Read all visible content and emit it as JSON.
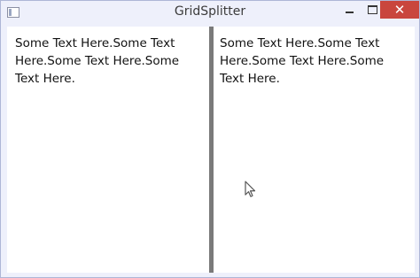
{
  "window": {
    "title": "GridSplitter",
    "controls": {
      "minimize_icon": "minimize-icon",
      "maximize_icon": "maximize-icon",
      "close_icon": "close-icon",
      "close_glyph": "✕"
    }
  },
  "panes": {
    "left_text": "Some Text Here.Some Text Here.Some Text Here.Some Text Here.",
    "right_text": "Some Text Here.Some Text Here.Some Text Here.Some Text Here."
  },
  "colors": {
    "close_button": "#c9463d",
    "splitter": "#7a7a7a",
    "chrome": "#eef0fb"
  }
}
